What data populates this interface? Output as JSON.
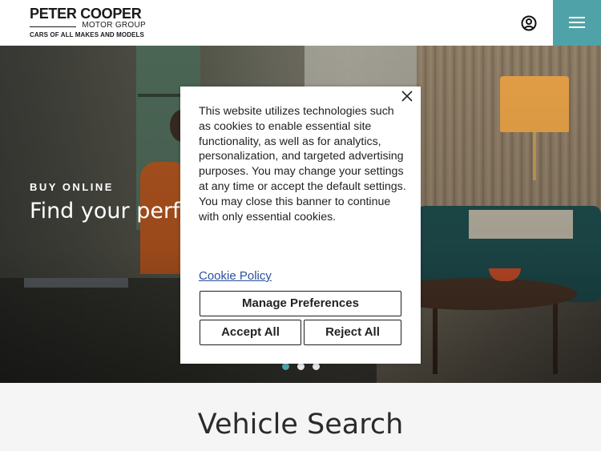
{
  "header": {
    "logo": {
      "name": "PETER COOPER",
      "subtitle": "MOTOR GROUP",
      "tagline": "CARS OF ALL MAKES AND MODELS"
    },
    "icons": {
      "account": "user-circle-icon",
      "menu": "hamburger-menu-icon"
    },
    "accent_color": "#4fa3a8"
  },
  "hero": {
    "eyebrow": "BUY ONLINE",
    "headline": "Find your perfe",
    "carousel": {
      "slide_count": 3,
      "active_index": 1
    }
  },
  "cookie_banner": {
    "message": "This website utilizes technologies such as cookies to enable essential site functionality, as well as for analytics, personalization, and targeted advertising purposes. You may change your settings at any time or accept the default settings. You may close this banner to continue with only essential cookies.",
    "policy_link": "Cookie Policy",
    "buttons": {
      "manage": "Manage Preferences",
      "accept": "Accept All",
      "reject": "Reject All"
    },
    "close_icon": "close-icon"
  },
  "vehicle_search": {
    "title": "Vehicle Search"
  }
}
